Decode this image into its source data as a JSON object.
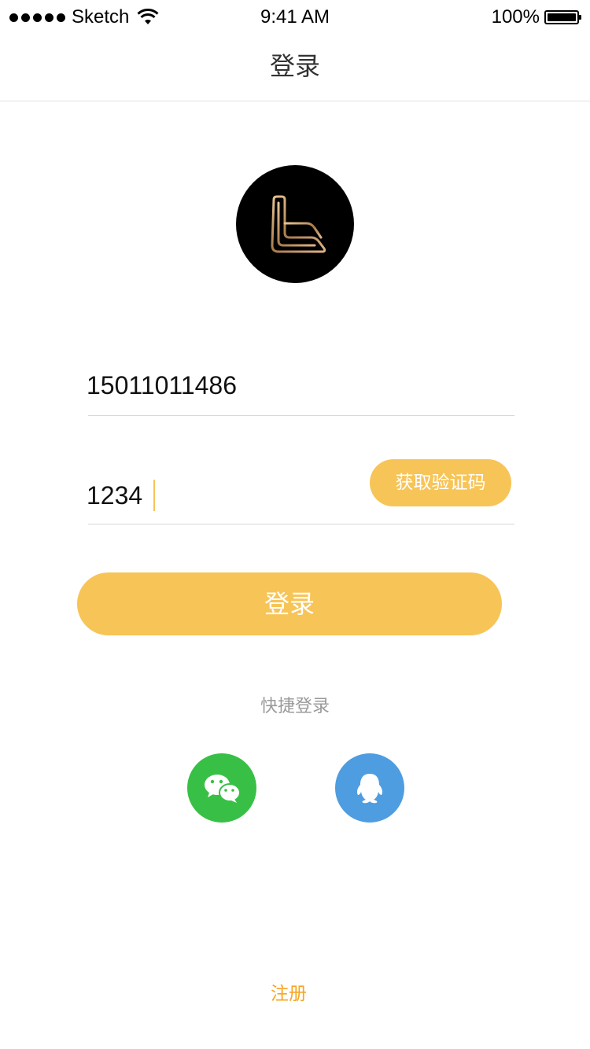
{
  "status_bar": {
    "carrier": "Sketch",
    "time": "9:41 AM",
    "battery": "100%",
    "signal_icon": "signal-dots-icon",
    "wifi_icon": "wifi-icon",
    "battery_icon": "battery-icon"
  },
  "nav": {
    "title": "登录"
  },
  "logo": {
    "icon": "brand-logo-icon",
    "background": "#000000",
    "accent": "#c8a06a"
  },
  "form": {
    "phone_value": "15011011486",
    "code_value": "1234",
    "get_code_label": "获取验证码",
    "login_label": "登录"
  },
  "quick_login": {
    "label": "快捷登录",
    "options": [
      {
        "name": "wechat",
        "icon": "wechat-icon",
        "color": "#38c046"
      },
      {
        "name": "qq",
        "icon": "qq-icon",
        "color": "#4e9de0"
      }
    ]
  },
  "footer": {
    "register_label": "注册"
  },
  "colors": {
    "accent": "#f7c457",
    "link": "#f5a623",
    "muted_text": "#9a9a9a"
  }
}
